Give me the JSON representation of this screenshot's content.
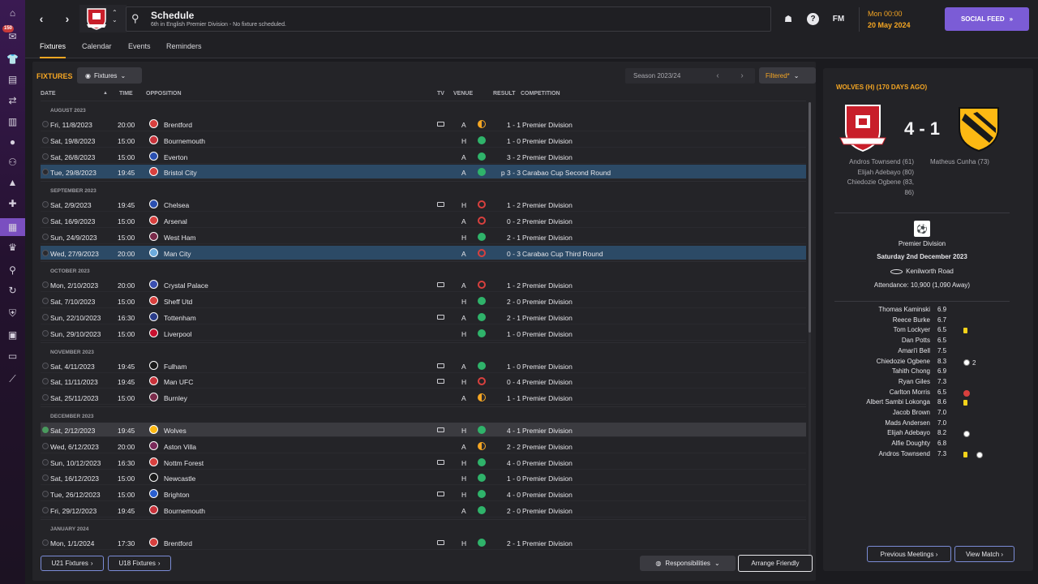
{
  "rail": {
    "badge": "150"
  },
  "header": {
    "title": "Schedule",
    "subtitle": "6th in English Premier Division - No fixture scheduled.",
    "fm_logo": "FM",
    "date_day": "Mon 00:00",
    "date_full": "20 May 2024",
    "social_label": "SOCIAL FEED",
    "help": "?"
  },
  "tabs": [
    "Fixtures",
    "Calendar",
    "Events",
    "Reminders"
  ],
  "fixtures": {
    "title": "FIXTURES",
    "dropdown": "Fixtures",
    "season": "Season 2023/24",
    "filter": "Filtered*",
    "columns": {
      "date": "DATE",
      "time": "TIME",
      "opposition": "OPPOSITION",
      "tv": "TV",
      "venue": "VENUE",
      "result": "RESULT",
      "competition": "COMPETITION"
    },
    "months": [
      "AUGUST 2023",
      "SEPTEMBER 2023",
      "OCTOBER 2023",
      "NOVEMBER 2023",
      "DECEMBER 2023",
      "JANUARY 2024"
    ],
    "rows": [
      {
        "month": 0,
        "date": "Fri, 11/8/2023",
        "time": "20:00",
        "opp": "Brentford",
        "tv": true,
        "venue": "A",
        "res": "D",
        "score": "1 - 1",
        "comp": "Premier Division",
        "crest": "#d8403e"
      },
      {
        "month": 0,
        "date": "Sat, 19/8/2023",
        "time": "15:00",
        "opp": "Bournemouth",
        "tv": false,
        "venue": "H",
        "res": "W",
        "score": "1 - 0",
        "comp": "Premier Division",
        "crest": "#c8323a"
      },
      {
        "month": 0,
        "date": "Sat, 26/8/2023",
        "time": "15:00",
        "opp": "Everton",
        "tv": false,
        "venue": "A",
        "res": "W",
        "score": "3 - 2",
        "comp": "Premier Division",
        "crest": "#2a4fb0"
      },
      {
        "month": 0,
        "date": "Tue, 29/8/2023",
        "time": "19:45",
        "opp": "Bristol City",
        "tv": false,
        "venue": "A",
        "res": "W",
        "score": "p 3 - 3",
        "comp": "Carabao Cup Second Round",
        "crest": "#d8403e",
        "hl": true
      },
      {
        "month": 1,
        "date": "Sat, 2/9/2023",
        "time": "19:45",
        "opp": "Chelsea",
        "tv": true,
        "venue": "H",
        "res": "L",
        "score": "1 - 2",
        "comp": "Premier Division",
        "crest": "#2a4fb0"
      },
      {
        "month": 1,
        "date": "Sat, 16/9/2023",
        "time": "15:00",
        "opp": "Arsenal",
        "tv": false,
        "venue": "A",
        "res": "L",
        "score": "0 - 2",
        "comp": "Premier Division",
        "crest": "#d8403e"
      },
      {
        "month": 1,
        "date": "Sun, 24/9/2023",
        "time": "15:00",
        "opp": "West Ham",
        "tv": false,
        "venue": "H",
        "res": "W",
        "score": "2 - 1",
        "comp": "Premier Division",
        "crest": "#7a2a4a"
      },
      {
        "month": 1,
        "date": "Wed, 27/9/2023",
        "time": "20:00",
        "opp": "Man City",
        "tv": false,
        "venue": "A",
        "res": "L",
        "score": "0 - 3",
        "comp": "Carabao Cup Third Round",
        "crest": "#6cabdd",
        "hl": true
      },
      {
        "month": 2,
        "date": "Mon, 2/10/2023",
        "time": "20:00",
        "opp": "Crystal Palace",
        "tv": true,
        "venue": "A",
        "res": "L",
        "score": "1 - 2",
        "comp": "Premier Division",
        "crest": "#3a4fb0"
      },
      {
        "month": 2,
        "date": "Sat, 7/10/2023",
        "time": "15:00",
        "opp": "Sheff Utd",
        "tv": false,
        "venue": "H",
        "res": "W",
        "score": "2 - 0",
        "comp": "Premier Division",
        "crest": "#d8403e"
      },
      {
        "month": 2,
        "date": "Sun, 22/10/2023",
        "time": "16:30",
        "opp": "Tottenham",
        "tv": true,
        "venue": "A",
        "res": "W",
        "score": "2 - 1",
        "comp": "Premier Division",
        "crest": "#2a3c8a"
      },
      {
        "month": 2,
        "date": "Sun, 29/10/2023",
        "time": "15:00",
        "opp": "Liverpool",
        "tv": false,
        "venue": "H",
        "res": "W",
        "score": "1 - 0",
        "comp": "Premier Division",
        "crest": "#c8102e"
      },
      {
        "month": 3,
        "date": "Sat, 4/11/2023",
        "time": "19:45",
        "opp": "Fulham",
        "tv": true,
        "venue": "A",
        "res": "W",
        "score": "1 - 0",
        "comp": "Premier Division",
        "crest": "#1a1a1a"
      },
      {
        "month": 3,
        "date": "Sat, 11/11/2023",
        "time": "19:45",
        "opp": "Man UFC",
        "tv": true,
        "venue": "H",
        "res": "L",
        "score": "0 - 4",
        "comp": "Premier Division",
        "crest": "#c8323a"
      },
      {
        "month": 3,
        "date": "Sat, 25/11/2023",
        "time": "15:00",
        "opp": "Burnley",
        "tv": false,
        "venue": "A",
        "res": "D",
        "score": "1 - 1",
        "comp": "Premier Division",
        "crest": "#7a2a4a"
      },
      {
        "month": 4,
        "date": "Sat, 2/12/2023",
        "time": "19:45",
        "opp": "Wolves",
        "tv": true,
        "venue": "H",
        "res": "W",
        "score": "4 - 1",
        "comp": "Premier Division",
        "crest": "#fdb913",
        "cur": true
      },
      {
        "month": 4,
        "date": "Wed, 6/12/2023",
        "time": "20:00",
        "opp": "Aston Villa",
        "tv": false,
        "venue": "A",
        "res": "D",
        "score": "2 - 2",
        "comp": "Premier Division",
        "crest": "#7a2a5a"
      },
      {
        "month": 4,
        "date": "Sun, 10/12/2023",
        "time": "16:30",
        "opp": "Nottm Forest",
        "tv": true,
        "venue": "H",
        "res": "W",
        "score": "4 - 0",
        "comp": "Premier Division",
        "crest": "#d8403e"
      },
      {
        "month": 4,
        "date": "Sat, 16/12/2023",
        "time": "15:00",
        "opp": "Newcastle",
        "tv": false,
        "venue": "H",
        "res": "W",
        "score": "1 - 0",
        "comp": "Premier Division",
        "crest": "#1a1a1a"
      },
      {
        "month": 4,
        "date": "Tue, 26/12/2023",
        "time": "15:00",
        "opp": "Brighton",
        "tv": true,
        "venue": "H",
        "res": "W",
        "score": "4 - 0",
        "comp": "Premier Division",
        "crest": "#2a5fd0"
      },
      {
        "month": 4,
        "date": "Fri, 29/12/2023",
        "time": "19:45",
        "opp": "Bournemouth",
        "tv": false,
        "venue": "A",
        "res": "W",
        "score": "2 - 0",
        "comp": "Premier Division",
        "crest": "#c8323a"
      },
      {
        "month": 5,
        "date": "Mon, 1/1/2024",
        "time": "17:30",
        "opp": "Brentford",
        "tv": true,
        "venue": "H",
        "res": "W",
        "score": "2 - 1",
        "comp": "Premier Division",
        "crest": "#d8403e"
      }
    ],
    "u21_label": "U21 Fixtures",
    "u18_label": "U18 Fixtures",
    "responsibilities_label": "Responsibilities",
    "arrange_label": "Arrange Friendly"
  },
  "match": {
    "title": "WOLVES (H) (170 DAYS AGO)",
    "score": "4 - 1",
    "home_scorers": [
      "Andros Townsend (61)",
      "Elijah Adebayo (80)",
      "Chiedozie Ogbene (83,",
      "86)"
    ],
    "away_scorers": [
      "Matheus Cunha (73)"
    ],
    "competition": "Premier Division",
    "date": "Saturday 2nd December 2023",
    "stadium": "Kenilworth Road",
    "attendance": "Attendance: 10,900 (1,090 Away)",
    "players": [
      {
        "name": "Thomas Kaminski",
        "rating": "6.9"
      },
      {
        "name": "Reece Burke",
        "rating": "6.7"
      },
      {
        "name": "Tom Lockyer",
        "rating": "6.5",
        "ev": [
          "yellow"
        ]
      },
      {
        "name": "Dan Potts",
        "rating": "6.5"
      },
      {
        "name": "Amari'i Bell",
        "rating": "7.5"
      },
      {
        "name": "Chiedozie Ogbene",
        "rating": "8.3",
        "ev": [
          "ball"
        ],
        "goals": "2"
      },
      {
        "name": "Tahith Chong",
        "rating": "6.9"
      },
      {
        "name": "Ryan Giles",
        "rating": "7.3"
      },
      {
        "name": "Carlton Morris",
        "rating": "6.5",
        "ev": [
          "red"
        ]
      },
      {
        "name": "Albert Sambi Lokonga",
        "rating": "8.6",
        "ev": [
          "yellow"
        ]
      },
      {
        "name": "Jacob Brown",
        "rating": "7.0"
      },
      {
        "name": "Mads Andersen",
        "rating": "7.0"
      },
      {
        "name": "Elijah Adebayo",
        "rating": "8.2",
        "ev": [
          "ball"
        ]
      },
      {
        "name": "Alfie Doughty",
        "rating": "6.8"
      },
      {
        "name": "Andros Townsend",
        "rating": "7.3",
        "ev": [
          "yellow",
          "ball"
        ]
      }
    ],
    "prev_meetings_label": "Previous Meetings",
    "view_match_label": "View Match"
  }
}
